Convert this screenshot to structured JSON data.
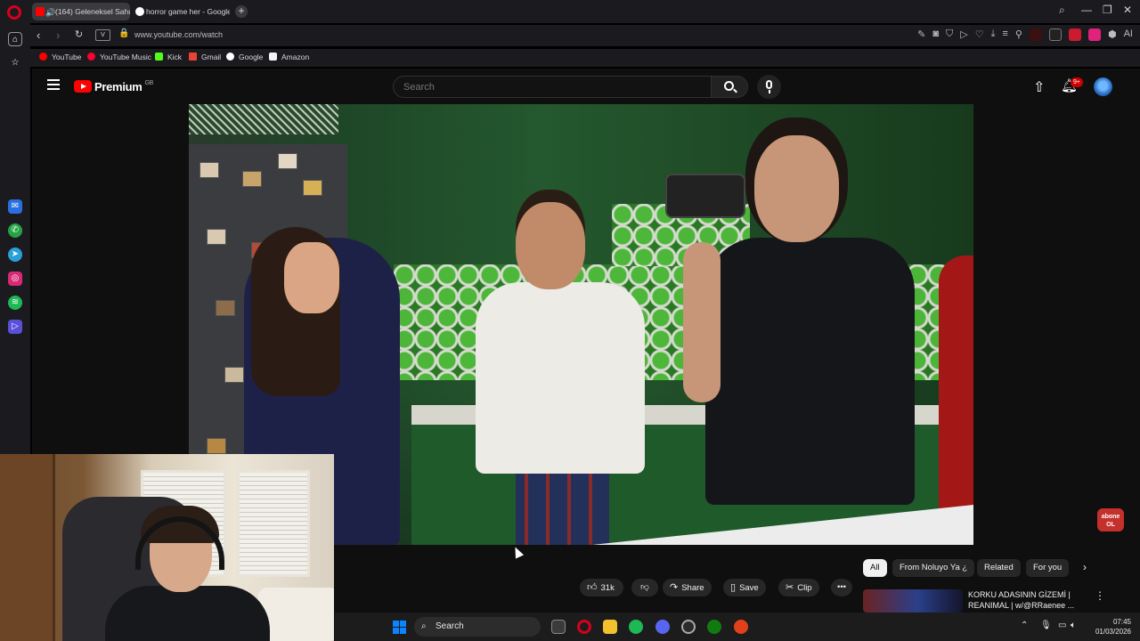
{
  "browser": {
    "tabs": [
      {
        "title": "(164) Geleneksel Sahur",
        "active": true,
        "audio": true
      },
      {
        "title": "horror game her - Google"
      }
    ],
    "url": "www.youtube.com/watch",
    "vpn_label": "V",
    "ai_label": "AI",
    "bookmarks": [
      "YouTube",
      "YouTube Music",
      "Kick",
      "Gmail",
      "Google",
      "Amazon"
    ],
    "accent": "#d6001c"
  },
  "youtube": {
    "brand": "Premium",
    "country_code": "GB",
    "search_placeholder": "Search",
    "notifications": "9+",
    "actions": {
      "likes": "31k",
      "share": "Share",
      "save": "Save",
      "clip": "Clip",
      "more": "•••"
    },
    "chips": [
      "All",
      "From Noluyo Ya ¿",
      "Related",
      "For you"
    ],
    "selected_chip": "All",
    "recommendation": {
      "title": "KORKU ADASININ GİZEMİ | REANIMAL | w/@RRaenee ..."
    },
    "watermark": "abone OL"
  },
  "taskbar": {
    "search_label": "Search",
    "time": "07:45",
    "date": "01/03/2026"
  }
}
